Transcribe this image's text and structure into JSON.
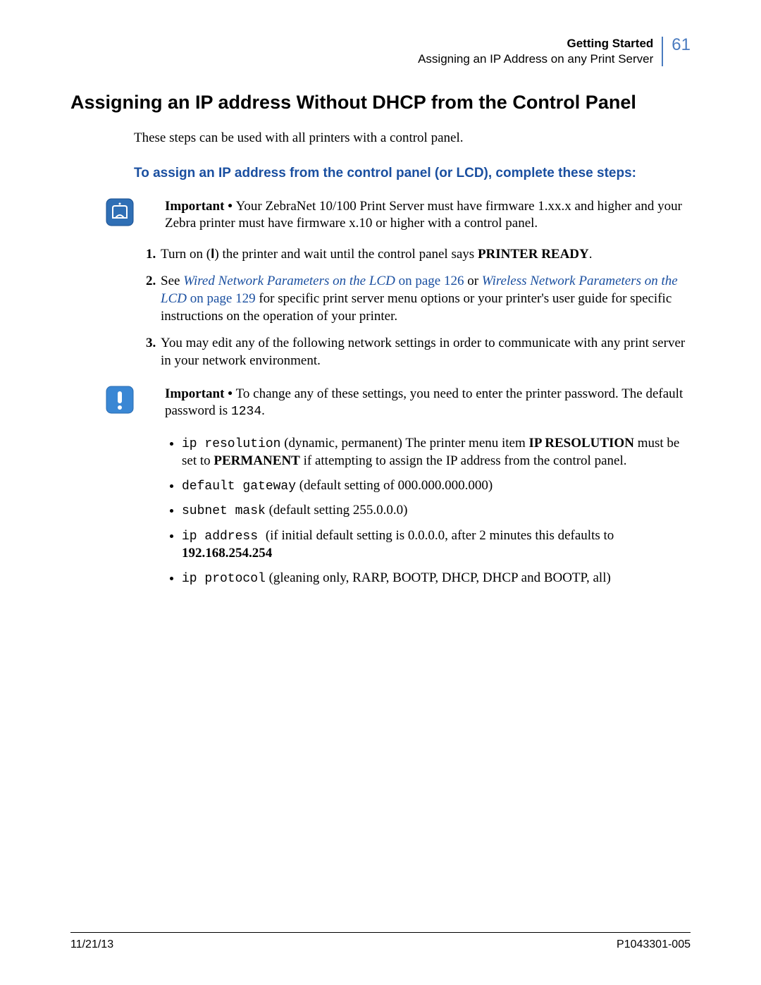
{
  "header": {
    "chapter": "Getting Started",
    "section": "Assigning an IP Address on any Print Server",
    "page_number": "61"
  },
  "main_heading": "Assigning an IP address Without DHCP from the Control Panel",
  "intro": "These steps can be used with all printers with a control panel.",
  "blue_subhead": "To assign an IP address from the control panel (or LCD), complete these steps:",
  "important1_label": "Important • ",
  "important1_text": "Your ZebraNet 10/100 Print Server must have firmware 1.xx.x and higher and your Zebra printer must have firmware x.10 or higher with a control panel.",
  "step1_a": "Turn on (",
  "step1_power": "I",
  "step1_b": ") the printer and wait until the control panel says ",
  "step1_bold": "PRINTER READY",
  "step1_c": ".",
  "step2_a": "See ",
  "step2_link1_italic": "Wired Network Parameters on the LCD",
  "step2_link1_page": " on page 126",
  "step2_or": " or ",
  "step2_link2_italic": "Wireless Network Parameters on the LCD",
  "step2_link2_page": " on page 129",
  "step2_tail": " for specific print server menu options or your printer's user guide for specific instructions on the operation of your printer.",
  "step3": "You may edit any of the following network settings in order to communicate with any print server in your network environment.",
  "important2_label": "Important • ",
  "important2_a": "To change any of these settings, you need to enter the printer password. The default password is ",
  "important2_code": "1234",
  "important2_b": ".",
  "bullets": {
    "b1_code": "ip resolution",
    "b1_a": " (dynamic, permanent) The printer menu item ",
    "b1_bold1": "IP RESOLUTION",
    "b1_b": " must be set to ",
    "b1_bold2": "PERMANENT",
    "b1_c": " if attempting to assign the IP address from the control panel.",
    "b2_code": "default gateway",
    "b2_text": " (default setting of 000.000.000.000)",
    "b3_code": "subnet mask",
    "b3_text": " (default setting 255.0.0.0)",
    "b4_code": "ip address ",
    "b4_a": " (if initial default setting is 0.0.0.0, after 2 minutes this defaults to ",
    "b4_bold": "192.168.254.254",
    "b5_code": "ip protocol",
    "b5_text": " (gleaning only, RARP, BOOTP, DHCP, DHCP and BOOTP, all)"
  },
  "footer": {
    "date": "11/21/13",
    "docnum": "P1043301-005"
  }
}
